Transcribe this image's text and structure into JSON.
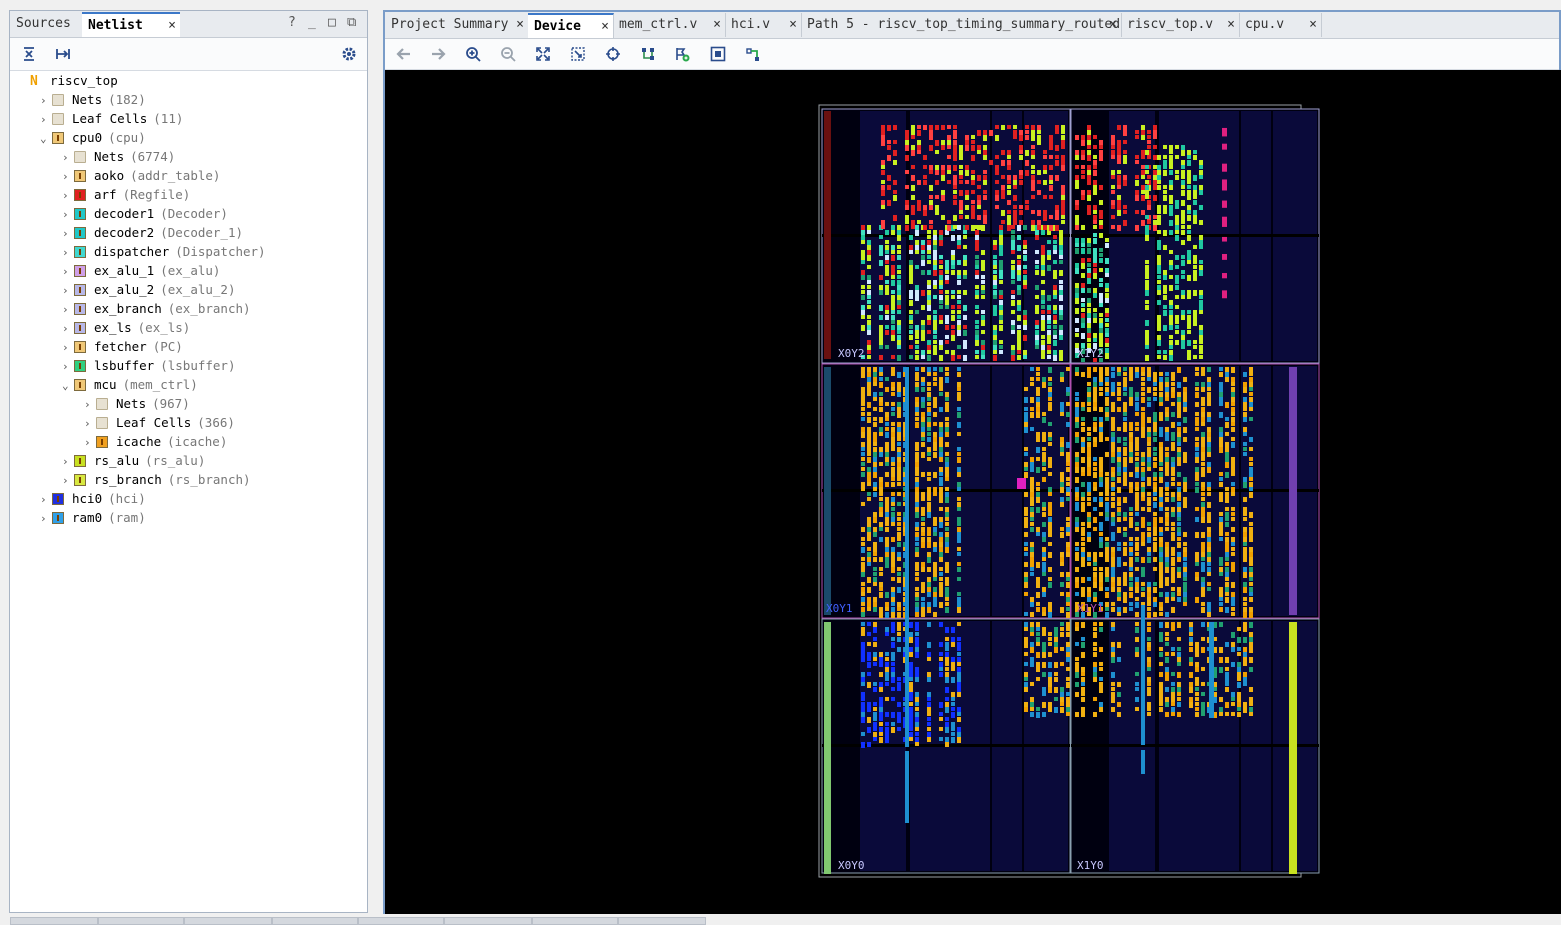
{
  "left": {
    "tabs": [
      {
        "label": "Sources"
      },
      {
        "label": "Netlist",
        "active": true
      }
    ],
    "controls": {
      "help": "?",
      "minimize": "_",
      "maximize": "□",
      "float": "⧉"
    },
    "tree": [
      {
        "depth": 0,
        "chev": "",
        "icon": "N",
        "iconColor": "#f0a000",
        "label": "riscv_top",
        "sub": ""
      },
      {
        "depth": 1,
        "chev": "›",
        "icon": "folder",
        "label": "Nets",
        "sub": "(182)"
      },
      {
        "depth": 1,
        "chev": "›",
        "icon": "folder",
        "label": "Leaf Cells",
        "sub": "(11)"
      },
      {
        "depth": 1,
        "chev": "⌄",
        "icon": "mod",
        "iconColor": "#f0c878",
        "label": "cpu0",
        "sub": "(cpu)"
      },
      {
        "depth": 2,
        "chev": "›",
        "icon": "folder",
        "label": "Nets",
        "sub": "(6774)"
      },
      {
        "depth": 2,
        "chev": "›",
        "icon": "mod",
        "iconColor": "#f0c878",
        "label": "aoko",
        "sub": "(addr_table)"
      },
      {
        "depth": 2,
        "chev": "›",
        "icon": "mod",
        "iconColor": "#e02020",
        "label": "arf",
        "sub": "(Regfile)"
      },
      {
        "depth": 2,
        "chev": "›",
        "icon": "mod",
        "iconColor": "#20c8c8",
        "label": "decoder1",
        "sub": "(Decoder)"
      },
      {
        "depth": 2,
        "chev": "›",
        "icon": "mod",
        "iconColor": "#20c8c8",
        "label": "decoder2",
        "sub": "(Decoder_1)"
      },
      {
        "depth": 2,
        "chev": "›",
        "icon": "mod",
        "iconColor": "#40d8d0",
        "label": "dispatcher",
        "sub": "(Dispatcher)"
      },
      {
        "depth": 2,
        "chev": "›",
        "icon": "mod",
        "iconColor": "#d0a0e8",
        "label": "ex_alu_1",
        "sub": "(ex_alu)"
      },
      {
        "depth": 2,
        "chev": "›",
        "icon": "mod",
        "iconColor": "#b8b8e8",
        "label": "ex_alu_2",
        "sub": "(ex_alu_2)"
      },
      {
        "depth": 2,
        "chev": "›",
        "icon": "mod",
        "iconColor": "#b8b8e8",
        "label": "ex_branch",
        "sub": "(ex_branch)"
      },
      {
        "depth": 2,
        "chev": "›",
        "icon": "mod",
        "iconColor": "#b8b8e8",
        "label": "ex_ls",
        "sub": "(ex_ls)"
      },
      {
        "depth": 2,
        "chev": "›",
        "icon": "mod",
        "iconColor": "#f0c878",
        "label": "fetcher",
        "sub": "(PC)"
      },
      {
        "depth": 2,
        "chev": "›",
        "icon": "mod",
        "iconColor": "#30d080",
        "label": "lsbuffer",
        "sub": "(lsbuffer)"
      },
      {
        "depth": 2,
        "chev": "⌄",
        "icon": "mod",
        "iconColor": "#f0c878",
        "label": "mcu",
        "sub": "(mem_ctrl)"
      },
      {
        "depth": 3,
        "chev": "›",
        "icon": "folder",
        "label": "Nets",
        "sub": "(967)"
      },
      {
        "depth": 3,
        "chev": "›",
        "icon": "folder",
        "label": "Leaf Cells",
        "sub": "(366)"
      },
      {
        "depth": 3,
        "chev": "›",
        "icon": "mod",
        "iconColor": "#f0a020",
        "label": "icache",
        "sub": "(icache)"
      },
      {
        "depth": 2,
        "chev": "›",
        "icon": "mod",
        "iconColor": "#c8e020",
        "label": "rs_alu",
        "sub": "(rs_alu)"
      },
      {
        "depth": 2,
        "chev": "›",
        "icon": "mod",
        "iconColor": "#d8e840",
        "label": "rs_branch",
        "sub": "(rs_branch)"
      },
      {
        "depth": 1,
        "chev": "›",
        "icon": "mod",
        "iconColor": "#2030e0",
        "label": "hci0",
        "sub": "(hci)"
      },
      {
        "depth": 1,
        "chev": "›",
        "icon": "mod",
        "iconColor": "#30a0e8",
        "label": "ram0",
        "sub": "(ram)"
      }
    ]
  },
  "right": {
    "tabs": [
      {
        "label": "Project Summary"
      },
      {
        "label": "Device",
        "active": true
      },
      {
        "label": "mem_ctrl.v"
      },
      {
        "label": "hci.v"
      },
      {
        "label": "Path 5 - riscv_top_timing_summary_routed"
      },
      {
        "label": "riscv_top.v"
      },
      {
        "label": "cpu.v"
      }
    ],
    "clock_regions": [
      "X0Y2",
      "X1Y2",
      "X0Y1",
      "X1Y1",
      "X0Y0",
      "X1Y0"
    ]
  },
  "colors": {
    "accent": "#3c78c8",
    "region_border": "#b0b8c0",
    "fabric": "#0a0a3a"
  }
}
